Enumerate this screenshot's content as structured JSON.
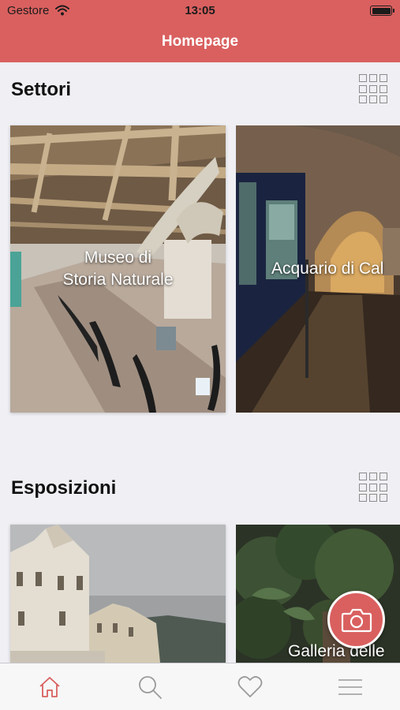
{
  "status_bar": {
    "carrier": "Gestore",
    "time": "13:05"
  },
  "nav": {
    "title": "Homepage"
  },
  "sections": [
    {
      "title": "Settori",
      "cards": [
        {
          "title": "Museo di\nStoria Naturale"
        },
        {
          "title": "Acquario di Cal"
        }
      ]
    },
    {
      "title": "Esposizioni",
      "cards": [
        {
          "title": ""
        },
        {
          "title": "Galleria delle"
        }
      ]
    }
  ],
  "tabs": [
    {
      "icon": "home-icon",
      "active": true
    },
    {
      "icon": "search-icon",
      "active": false
    },
    {
      "icon": "heart-icon",
      "active": false
    },
    {
      "icon": "menu-icon",
      "active": false
    }
  ],
  "colors": {
    "accent": "#d9605f",
    "tab_inactive": "#9a9a9a",
    "background": "#efeff4"
  }
}
